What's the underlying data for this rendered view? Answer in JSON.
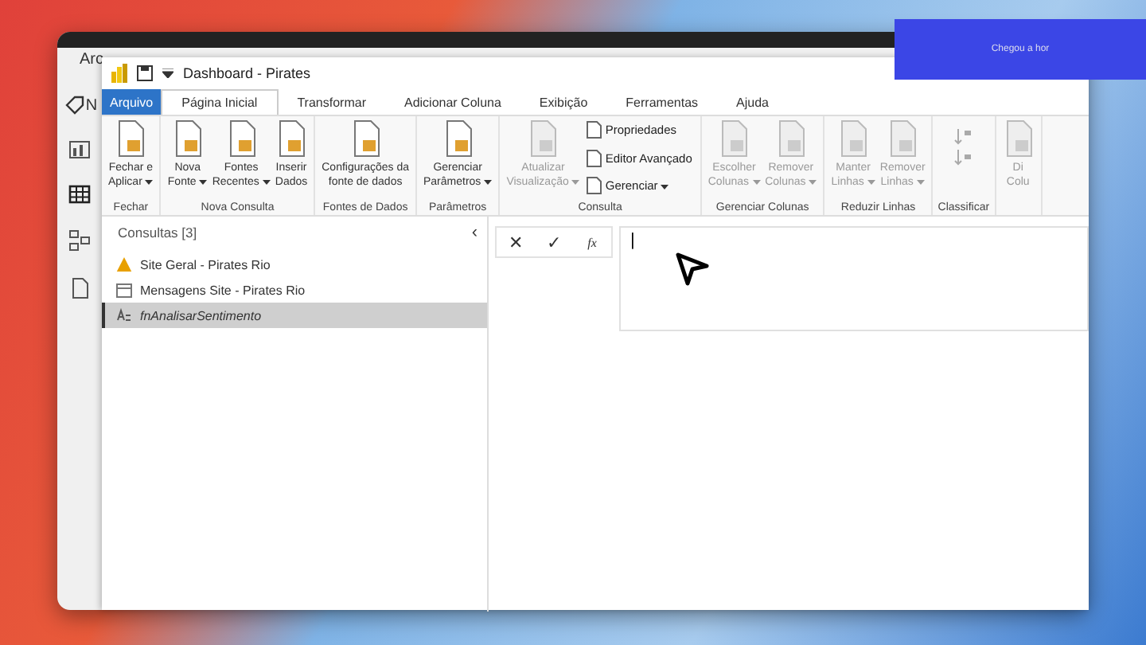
{
  "banner": {
    "text": "Chegou a hor"
  },
  "back_window": {
    "menu": [
      "Arc"
    ],
    "side_label": "N"
  },
  "window": {
    "title": "Dashboard - Pirates"
  },
  "tabs": [
    {
      "label": "Arquivo",
      "kind": "file",
      "selected": false
    },
    {
      "label": "Página Inicial",
      "kind": "tab",
      "selected": true
    },
    {
      "label": "Transformar",
      "kind": "tab",
      "selected": false
    },
    {
      "label": "Adicionar Coluna",
      "kind": "tab",
      "selected": false
    },
    {
      "label": "Exibição",
      "kind": "tab",
      "selected": false
    },
    {
      "label": "Ferramentas",
      "kind": "tab",
      "selected": false
    },
    {
      "label": "Ajuda",
      "kind": "tab",
      "selected": false
    }
  ],
  "ribbon": [
    {
      "label": "Fechar",
      "buttons": [
        {
          "kind": "large",
          "lines": [
            "Fechar e",
            "Aplicar"
          ],
          "dropdown": true,
          "disabled": false
        }
      ]
    },
    {
      "label": "Nova Consulta",
      "buttons": [
        {
          "kind": "large",
          "lines": [
            "Nova",
            "Fonte"
          ],
          "dropdown": true,
          "disabled": false
        },
        {
          "kind": "large",
          "lines": [
            "Fontes",
            "Recentes"
          ],
          "dropdown": true,
          "disabled": false
        },
        {
          "kind": "large",
          "lines": [
            "Inserir",
            "Dados"
          ],
          "dropdown": false,
          "disabled": false
        }
      ]
    },
    {
      "label": "Fontes de Dados",
      "buttons": [
        {
          "kind": "large",
          "lines": [
            "Configurações da",
            "fonte de dados"
          ],
          "dropdown": false,
          "disabled": false
        }
      ]
    },
    {
      "label": "Parâmetros",
      "buttons": [
        {
          "kind": "large",
          "lines": [
            "Gerenciar",
            "Parâmetros"
          ],
          "dropdown": true,
          "disabled": false
        }
      ]
    },
    {
      "label": "Consulta",
      "buttons": [
        {
          "kind": "large",
          "lines": [
            "Atualizar",
            "Visualização"
          ],
          "dropdown": true,
          "disabled": true
        },
        {
          "kind": "small",
          "lines": [
            "Propriedades"
          ],
          "dropdown": false,
          "disabled": false
        },
        {
          "kind": "small",
          "lines": [
            "Editor Avançado"
          ],
          "dropdown": false,
          "disabled": false
        },
        {
          "kind": "small",
          "lines": [
            "Gerenciar"
          ],
          "dropdown": true,
          "disabled": false
        }
      ]
    },
    {
      "label": "Gerenciar Colunas",
      "buttons": [
        {
          "kind": "large",
          "lines": [
            "Escolher",
            "Colunas"
          ],
          "dropdown": true,
          "disabled": true
        },
        {
          "kind": "large",
          "lines": [
            "Remover",
            "Colunas"
          ],
          "dropdown": true,
          "disabled": true
        }
      ]
    },
    {
      "label": "Reduzir Linhas",
      "buttons": [
        {
          "kind": "large",
          "lines": [
            "Manter",
            "Linhas"
          ],
          "dropdown": true,
          "disabled": true
        },
        {
          "kind": "large",
          "lines": [
            "Remover",
            "Linhas"
          ],
          "dropdown": true,
          "disabled": true
        }
      ]
    },
    {
      "label": "Classificar",
      "buttons": [
        {
          "kind": "sort",
          "disabled": true
        }
      ]
    },
    {
      "buttons": [
        {
          "kind": "large",
          "lines": [
            "Di",
            "Colu"
          ],
          "dropdown": false,
          "disabled": true
        }
      ]
    }
  ],
  "queries": {
    "title": "Consultas [3]",
    "collapse": "‹",
    "items": [
      {
        "name": "Site Geral - Pirates Rio",
        "kind": "warning",
        "selected": false
      },
      {
        "name": "Mensagens Site - Pirates Rio",
        "kind": "table",
        "selected": false
      },
      {
        "name": "fnAnalisarSentimento",
        "kind": "function",
        "selected": true
      }
    ]
  },
  "formula_bar": {
    "cancel": "✕",
    "confirm": "✓",
    "fx": "fx",
    "value": "|"
  }
}
